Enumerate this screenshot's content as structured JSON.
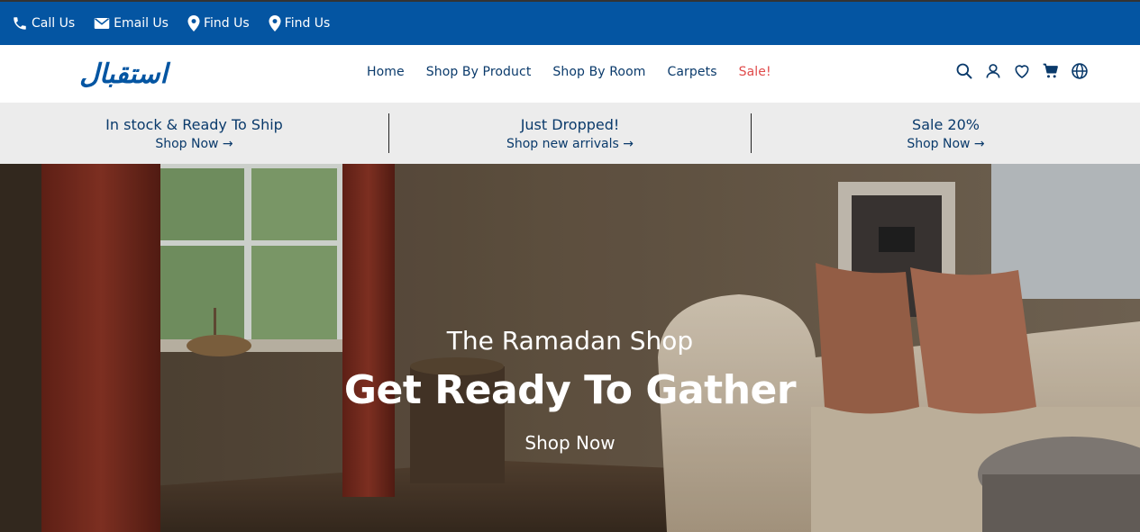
{
  "topbar": {
    "links": [
      {
        "label": "Call Us",
        "icon": "phone-icon"
      },
      {
        "label": "Email Us",
        "icon": "envelope-icon"
      },
      {
        "label": "Find Us",
        "icon": "map-pin-icon"
      },
      {
        "label": "Find Us",
        "icon": "map-pin-icon"
      }
    ],
    "background": "#0455a2"
  },
  "header": {
    "logo_text": "استقبال",
    "nav": [
      {
        "label": "Home"
      },
      {
        "label": "Shop By Product"
      },
      {
        "label": "Shop By Room"
      },
      {
        "label": "Carpets"
      },
      {
        "label": "Sale!",
        "color": "#e04b4b"
      }
    ],
    "icons": [
      "search-icon",
      "user-icon",
      "heart-icon",
      "cart-icon",
      "globe-icon"
    ]
  },
  "promo": [
    {
      "title": "In stock & Ready To Ship",
      "link": "Shop Now →"
    },
    {
      "title": "Just Dropped!",
      "link": "Shop new arrivals →"
    },
    {
      "title": "Sale 20%",
      "link": "Shop Now →"
    }
  ],
  "hero": {
    "subtitle": "The Ramadan Shop",
    "title": "Get Ready To Gather",
    "cta": "Shop Now"
  },
  "colors": {
    "brand_blue": "#0455a2",
    "text_navy": "#0a3a6b",
    "sale_red": "#e04b4b",
    "promo_bg": "#ececec"
  }
}
